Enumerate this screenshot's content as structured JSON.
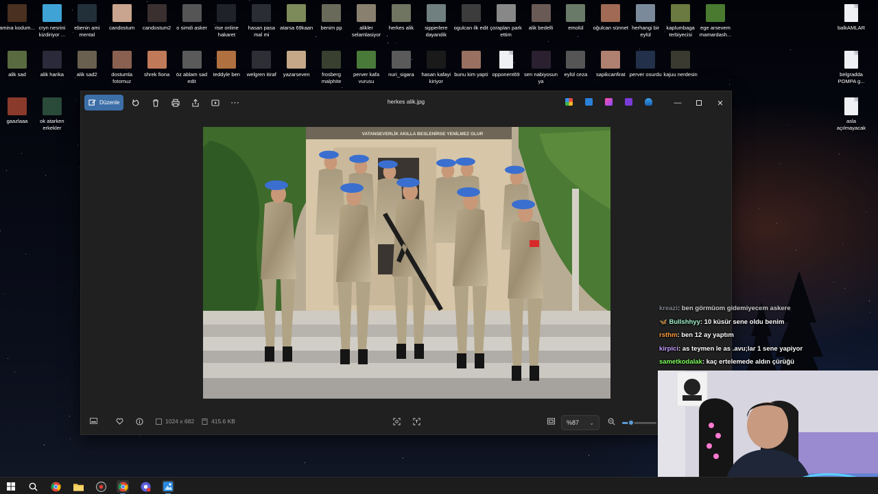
{
  "desktop": {
    "row1": [
      {
        "label": "amina kodum...",
        "color": "#4a3020"
      },
      {
        "label": "cryn nesrini kizdiriyor ...",
        "color": "#3fa3d6"
      },
      {
        "label": "ebenin ami mental",
        "color": "#22303a"
      },
      {
        "label": "candostum",
        "color": "#c9a48e"
      },
      {
        "label": "candostum2",
        "color": "#3a3030"
      },
      {
        "label": "o simdi asker",
        "color": "#555"
      },
      {
        "label": "rise online hakaret",
        "color": "#1f2228"
      },
      {
        "label": "hasan pasa mal mi",
        "color": "#2a2d33"
      },
      {
        "label": "atarsa 69kaan",
        "color": "#7d8a5a"
      },
      {
        "label": "benim pp",
        "color": "#6a6a5a"
      },
      {
        "label": "alikler selamlasiyor",
        "color": "#8a8070"
      },
      {
        "label": "herkes alik",
        "color": "#6f7560"
      },
      {
        "label": "sipperlere dayandik",
        "color": "#708080"
      },
      {
        "label": "ogulcan ilk edit",
        "color": "#3c3c3c"
      },
      {
        "label": "çorapları park ettim",
        "color": "#888"
      },
      {
        "label": "alik bedelli",
        "color": "#6a5a55"
      },
      {
        "label": "emolül",
        "color": "#6a7a68"
      },
      {
        "label": "oğulcan sünnet",
        "color": "#a06a55"
      },
      {
        "label": "herhangi bir eylül",
        "color": "#7a8a9a"
      },
      {
        "label": "kaplumbaga terbiyecisi",
        "color": "#6a7a40"
      },
      {
        "label": "ege arsevem mamardash...",
        "color": "#4a7a30"
      }
    ],
    "row2": [
      {
        "label": "alik sad",
        "color": "#5a6a40"
      },
      {
        "label": "alik harika",
        "color": "#2a2a3a"
      },
      {
        "label": "alik sad2",
        "color": "#6a6050"
      },
      {
        "label": "dostumla fotomuz",
        "color": "#8a6050"
      },
      {
        "label": "shrek fiona",
        "color": "#c07a5a"
      },
      {
        "label": "öz ablam sad edit",
        "color": "#5a5a5a"
      },
      {
        "label": "teddyle ben",
        "color": "#b07040"
      },
      {
        "label": "welgren itiraf",
        "color": "#2d2f35"
      },
      {
        "label": "yazarseven",
        "color": "#c4a888"
      },
      {
        "label": "frosberg malphite",
        "color": "#3a4030"
      },
      {
        "label": "perver kafa vurusu",
        "color": "#4a7a3a"
      },
      {
        "label": "nuri_sigara",
        "color": "#5a5a5a"
      },
      {
        "label": "hasan kafayi kiriyor",
        "color": "#1a1a1a"
      },
      {
        "label": "bunu kim yapti",
        "color": "#9a7060"
      },
      {
        "label": "opponent69",
        "color": "doc"
      },
      {
        "label": "sen nabiyosun ya",
        "color": "#2a2030"
      },
      {
        "label": "eylül ceza",
        "color": "#555"
      },
      {
        "label": "sapikcanfirat",
        "color": "#b08070"
      },
      {
        "label": "perver osurdu",
        "color": "#22304a"
      },
      {
        "label": "kajuu nerdesin",
        "color": "#3a3a30"
      }
    ],
    "row3": [
      {
        "label": "gaazlaaa",
        "color": "#8a3a2a"
      },
      {
        "label": "ok atarken erkekler",
        "color": "#2a4a3a"
      }
    ],
    "right_icons": [
      {
        "label": "balkAMLAR",
        "color": "doc"
      },
      {
        "label": "belgradda POMPA g...",
        "color": "doc"
      },
      {
        "label": "asla açılmayacak",
        "color": "doc"
      }
    ]
  },
  "viewer": {
    "edit_label": "Düzenle",
    "file_title": "herkes alik.jpg",
    "photo_banner": "VATANSEVERLİK AKILLA BESLENİRSE YENİLMEZ OLUR",
    "dimensions": "1024 x 682",
    "file_size": "415.6 KB",
    "zoom_label": "%87",
    "zoom_level": 0.25
  },
  "chat": [
    {
      "user": "kreazi",
      "color": "#9aa0aa",
      "msg": ": ben görmüom gidemiyecem askere",
      "badge": false
    },
    {
      "user": "Bullshhyy",
      "color": "#9ef0c8",
      "msg": ": 10 küsür sene oldu benim",
      "badge": true
    },
    {
      "user": "rsthm",
      "color": "#ff9a3c",
      "msg": ": ben 12 ay yaptım",
      "badge": false
    },
    {
      "user": "kirpici",
      "color": "#c59bff",
      "msg": ": as teymen le as .avu;lar 1 sene yapiyor",
      "badge": false
    },
    {
      "user": "sametkodalak",
      "color": "#7cff5a",
      "msg": ": kaç ertelemede aldın çürüğü",
      "badge": false
    }
  ]
}
